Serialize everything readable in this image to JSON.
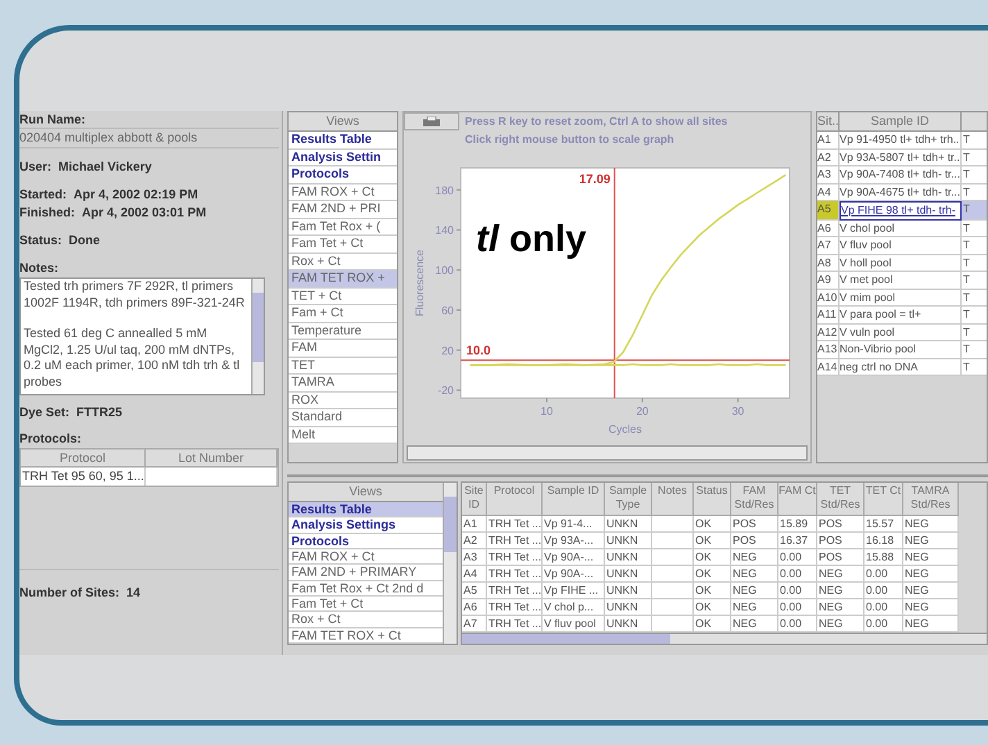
{
  "run_info": {
    "run_name_label": "Run Name:",
    "run_name": "020404 multiplex abbott & pools",
    "fields": [
      {
        "label": "User:",
        "value": "Michael Vickery"
      },
      {
        "label": "Started:",
        "value": "Apr 4, 2002 02:19 PM"
      },
      {
        "label": "Finished:",
        "value": "Apr 4, 2002 03:01 PM"
      },
      {
        "label": "Status:",
        "value": "Done"
      }
    ],
    "notes_label": "Notes:",
    "notes": [
      "Tested trh primers 7F 292R, tl primers 1002F 1194R, tdh primers 89F-321-24R",
      "Tested 61 deg C annealled 5 mM MgCl2, 1.25 U/ul taq, 200 mM dNTPs, 0.2 uM each primer, 100 nM tdh trh & tl probes"
    ],
    "dye_set": {
      "label": "Dye Set:",
      "value": "FTTR25"
    },
    "protocols_label": "Protocols:",
    "protocols": {
      "columns": [
        "Protocol",
        "Lot Number"
      ],
      "rows": [
        [
          "TRH Tet 95 60, 95 1...",
          ""
        ]
      ]
    },
    "sites": {
      "label": "Number of Sites:",
      "value": "14"
    }
  },
  "views_top": {
    "header": "Views",
    "items": [
      {
        "label": "Results Table",
        "kind": "group",
        "selected": false
      },
      {
        "label": "Analysis Settin",
        "kind": "group",
        "selected": false
      },
      {
        "label": "Protocols",
        "kind": "group",
        "selected": false
      },
      {
        "label": "FAM ROX + Ct",
        "kind": "item",
        "selected": false
      },
      {
        "label": "FAM 2ND + PRI",
        "kind": "item",
        "selected": false
      },
      {
        "label": "Fam Tet Rox + (",
        "kind": "item",
        "selected": false
      },
      {
        "label": "Fam Tet + Ct",
        "kind": "item",
        "selected": false
      },
      {
        "label": "Rox + Ct",
        "kind": "item",
        "selected": false
      },
      {
        "label": "FAM TET ROX +",
        "kind": "item",
        "selected": true
      },
      {
        "label": "TET + Ct",
        "kind": "item",
        "selected": false
      },
      {
        "label": "Fam + Ct",
        "kind": "item",
        "selected": false
      },
      {
        "label": "Temperature",
        "kind": "item",
        "selected": false
      },
      {
        "label": "FAM",
        "kind": "item",
        "selected": false
      },
      {
        "label": "TET",
        "kind": "item",
        "selected": false
      },
      {
        "label": "TAMRA",
        "kind": "item",
        "selected": false
      },
      {
        "label": "ROX",
        "kind": "item",
        "selected": false
      },
      {
        "label": "Standard",
        "kind": "item",
        "selected": false
      },
      {
        "label": "Melt",
        "kind": "item",
        "selected": false
      }
    ]
  },
  "chart_panel": {
    "hint_lines": [
      "Press R key to reset zoom, Ctrl A to show all sites",
      "Click right mouse button to scale graph"
    ],
    "chart_data": {
      "type": "line",
      "xlabel": "Cycles",
      "ylabel": "Fluorescence",
      "xlim": [
        1,
        35.4
      ],
      "ylim": [
        -28,
        202
      ],
      "xticks": [
        10,
        20,
        30
      ],
      "yticks": [
        -20,
        20,
        60,
        100,
        140,
        180
      ],
      "x": [
        2,
        4,
        6,
        8,
        10,
        12,
        14,
        16,
        17,
        18,
        19,
        20,
        21,
        22,
        23,
        24,
        25,
        26,
        27,
        28,
        29,
        30,
        31,
        32,
        33,
        34,
        35
      ],
      "series": [
        {
          "color": "#d6d65a",
          "values": [
            5,
            5,
            5,
            5,
            5,
            5,
            5,
            6,
            8,
            18,
            35,
            55,
            75,
            90,
            103,
            115,
            125,
            135,
            143,
            151,
            158,
            165,
            171,
            177,
            183,
            189,
            195
          ]
        },
        {
          "color": "#d6d65a",
          "values": [
            5,
            5,
            6,
            5,
            5,
            6,
            5,
            5,
            5,
            5,
            6,
            5,
            5,
            5,
            6,
            5,
            5,
            5,
            5,
            6,
            5,
            5,
            5,
            6,
            5,
            5,
            5
          ]
        }
      ],
      "ref_lines": [
        {
          "axis": "x",
          "value": 17.09,
          "label": "17.09"
        },
        {
          "axis": "y",
          "value": 10,
          "label": "10.0"
        }
      ],
      "annotations": [
        "*tl* only"
      ]
    }
  },
  "sites_table": {
    "columns": [
      "Sit..",
      "Sample ID"
    ],
    "rows": [
      {
        "site": "A1",
        "sample": "Vp 91-4950 tl+ tdh+ trh...",
        "column_3": "T",
        "selected": false
      },
      {
        "site": "A2",
        "sample": "Vp 93A-5807 tl+ tdh+ tr...",
        "column_3": "T",
        "selected": false
      },
      {
        "site": "A3",
        "sample": "Vp 90A-7408 tl+ tdh- tr...",
        "column_3": "T",
        "selected": false
      },
      {
        "site": "A4",
        "sample": "Vp 90A-4675 tl+ tdh- tr...",
        "column_3": "T",
        "selected": false
      },
      {
        "site": "A5",
        "sample": "Vp FIHE 98 tl+ tdh- trh-",
        "column_3": "T",
        "selected": true
      },
      {
        "site": "A6",
        "sample": "V chol pool",
        "column_3": "T",
        "selected": false
      },
      {
        "site": "A7",
        "sample": "V fluv pool",
        "column_3": "T",
        "selected": false
      },
      {
        "site": "A8",
        "sample": "V holl pool",
        "column_3": "T",
        "selected": false
      },
      {
        "site": "A9",
        "sample": "V met pool",
        "column_3": "T",
        "selected": false
      },
      {
        "site": "A10",
        "sample": "V mim pool",
        "column_3": "T",
        "selected": false
      },
      {
        "site": "A11",
        "sample": "V para pool = tl+",
        "column_3": "T",
        "selected": false
      },
      {
        "site": "A12",
        "sample": "V vuln pool",
        "column_3": "T",
        "selected": false
      },
      {
        "site": "A13",
        "sample": "Non-Vibrio pool",
        "column_3": "T",
        "selected": false
      },
      {
        "site": "A14",
        "sample": "neg ctrl no DNA",
        "column_3": "T",
        "selected": false
      }
    ]
  },
  "views_bottom": {
    "header": "Views",
    "items": [
      {
        "label": "Results Table",
        "kind": "group",
        "selected": true
      },
      {
        "label": "Analysis Settings",
        "kind": "group",
        "selected": false
      },
      {
        "label": "Protocols",
        "kind": "group",
        "selected": false
      },
      {
        "label": "FAM ROX + Ct",
        "kind": "item",
        "selected": false
      },
      {
        "label": "FAM 2ND + PRIMARY",
        "kind": "item",
        "selected": false
      },
      {
        "label": "Fam Tet Rox + Ct 2nd d",
        "kind": "item",
        "selected": false
      },
      {
        "label": "Fam Tet + Ct",
        "kind": "item",
        "selected": false
      },
      {
        "label": "Rox + Ct",
        "kind": "item",
        "selected": false
      },
      {
        "label": "FAM TET ROX + Ct",
        "kind": "item",
        "selected": false
      }
    ]
  },
  "results_table": {
    "columns": [
      "Site ID",
      "Protocol",
      "Sample ID",
      "Sample Type",
      "Notes",
      "Status",
      "FAM Std/Res",
      "FAM Ct",
      "TET Std/Res",
      "TET Ct",
      "TAMRA Std/Res"
    ],
    "rows": [
      [
        "A1",
        "TRH Tet ...",
        "Vp 91-4...",
        "UNKN",
        "",
        "OK",
        "POS",
        "15.89",
        "POS",
        "15.57",
        "NEG"
      ],
      [
        "A2",
        "TRH Tet ...",
        "Vp 93A-...",
        "UNKN",
        "",
        "OK",
        "POS",
        "16.37",
        "POS",
        "16.18",
        "NEG"
      ],
      [
        "A3",
        "TRH Tet ...",
        "Vp 90A-...",
        "UNKN",
        "",
        "OK",
        "NEG",
        "0.00",
        "POS",
        "15.88",
        "NEG"
      ],
      [
        "A4",
        "TRH Tet ...",
        "Vp 90A-...",
        "UNKN",
        "",
        "OK",
        "NEG",
        "0.00",
        "NEG",
        "0.00",
        "NEG"
      ],
      [
        "A5",
        "TRH Tet ...",
        "Vp FIHE ...",
        "UNKN",
        "",
        "OK",
        "NEG",
        "0.00",
        "NEG",
        "0.00",
        "NEG"
      ],
      [
        "A6",
        "TRH Tet ...",
        "V chol p...",
        "UNKN",
        "",
        "OK",
        "NEG",
        "0.00",
        "NEG",
        "0.00",
        "NEG"
      ],
      [
        "A7",
        "TRH Tet ...",
        "V fluv pool",
        "UNKN",
        "",
        "OK",
        "NEG",
        "0.00",
        "NEG",
        "0.00",
        "NEG"
      ]
    ]
  }
}
